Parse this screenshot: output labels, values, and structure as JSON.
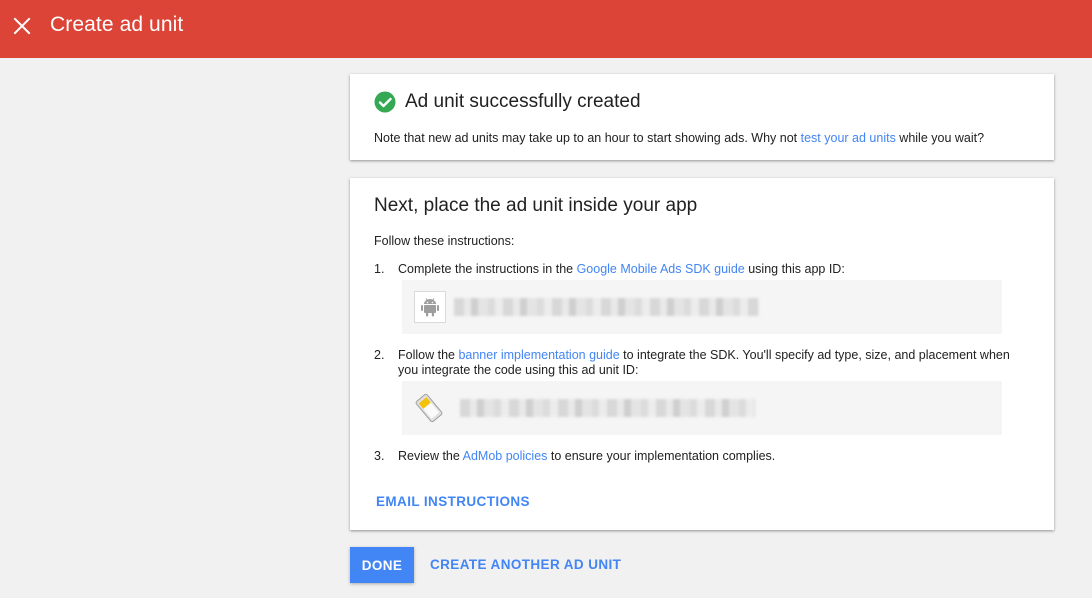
{
  "header": {
    "title": "Create ad unit",
    "close_icon": "close-icon",
    "background_color": "#db4437"
  },
  "success_card": {
    "icon": "check-circle-icon",
    "icon_color": "#34a853",
    "title": "Ad unit successfully created",
    "note_prefix": "Note that new ad units may take up to an hour to start showing ads.  Why not ",
    "note_link": "test your ad units",
    "note_suffix": " while you wait?"
  },
  "instructions_card": {
    "title": "Next, place the ad unit inside your app",
    "intro": "Follow these instructions:",
    "steps": [
      {
        "num": "1.",
        "prefix": "Complete the instructions in the ",
        "link": "Google Mobile Ads SDK guide",
        "suffix": " using this app ID:",
        "icon": "android-icon"
      },
      {
        "num": "2.",
        "prefix": "Follow the ",
        "link": "banner implementation guide",
        "suffix": " to integrate the SDK. You'll specify ad type, size, and placement when you integrate the code using this ad unit ID:",
        "icon": "banner-ad-unit-icon"
      },
      {
        "num": "3.",
        "prefix": "Review the ",
        "link": "AdMob policies",
        "suffix": " to ensure your implementation complies."
      }
    ],
    "email_button": "EMAIL INSTRUCTIONS"
  },
  "actions": {
    "done": "DONE",
    "create_another": "CREATE ANOTHER AD UNIT"
  },
  "colors": {
    "accent": "#4285f4",
    "background": "#f1f1f1"
  }
}
